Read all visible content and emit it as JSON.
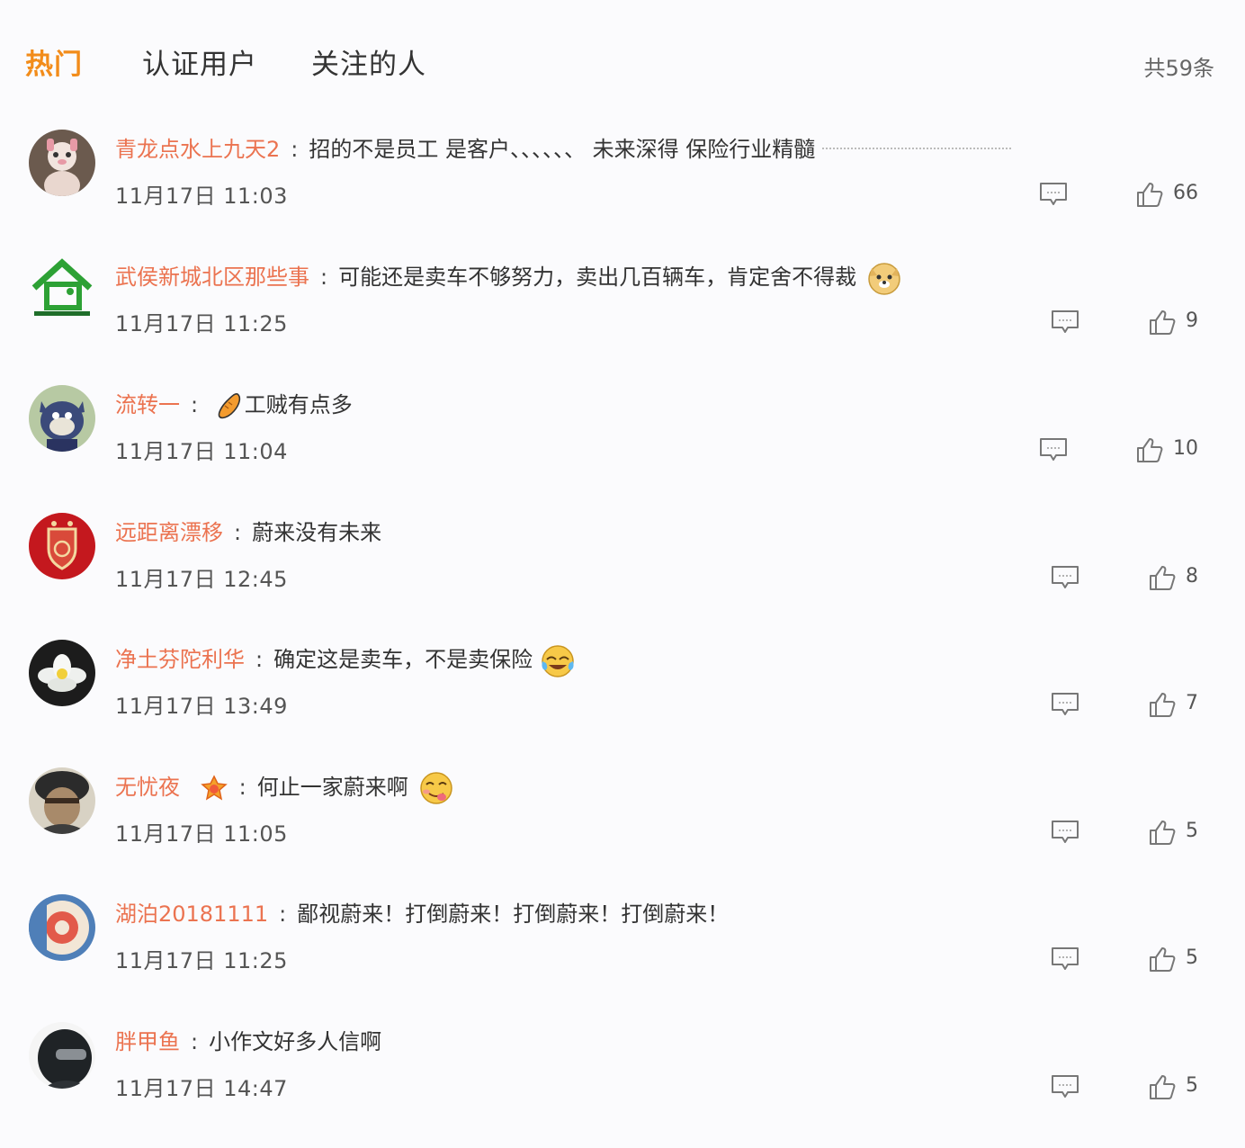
{
  "tabs": [
    {
      "label": "热门",
      "active": true
    },
    {
      "label": "认证用户",
      "active": false
    },
    {
      "label": "关注的人",
      "active": false
    }
  ],
  "total_label": "共59条",
  "colors": {
    "accent": "#f28c1a",
    "username": "#eb7350"
  },
  "comments": [
    {
      "user": "青龙点水上九天2",
      "colon": ":",
      "text": "招的不是员工 是客户、、、、、、 未来深得 保险行业精髓",
      "time": "11月17日 11:03",
      "likes": "66"
    },
    {
      "user": "武侯新城北区那些事",
      "colon": ":",
      "text": "可能还是卖车不够努力，卖出几百辆车，肯定舍不得裁",
      "time": "11月17日 11:25",
      "likes": "9"
    },
    {
      "user": "流转一",
      "colon": ":",
      "text": "工贼有点多",
      "time": "11月17日 11:04",
      "likes": "10"
    },
    {
      "user": "远距离漂移",
      "colon": ":",
      "text": "蔚来没有未来",
      "time": "11月17日 12:45",
      "likes": "8"
    },
    {
      "user": "净土芬陀利华",
      "colon": ":",
      "text": "确定这是卖车，不是卖保险",
      "time": "11月17日 13:49",
      "likes": "7"
    },
    {
      "user": "无忧夜",
      "colon": ":",
      "text": "何止一家蔚来啊",
      "time": "11月17日 11:05",
      "likes": "5"
    },
    {
      "user": "湖泊20181111",
      "colon": ":",
      "text": "鄙视蔚来！打倒蔚来！打倒蔚来！打倒蔚来！",
      "time": "11月17日 11:25",
      "likes": "5"
    },
    {
      "user": "胖甲鱼",
      "colon": ":",
      "text": "小作文好多人信啊",
      "time": "11月17日 14:47",
      "likes": "5"
    }
  ]
}
